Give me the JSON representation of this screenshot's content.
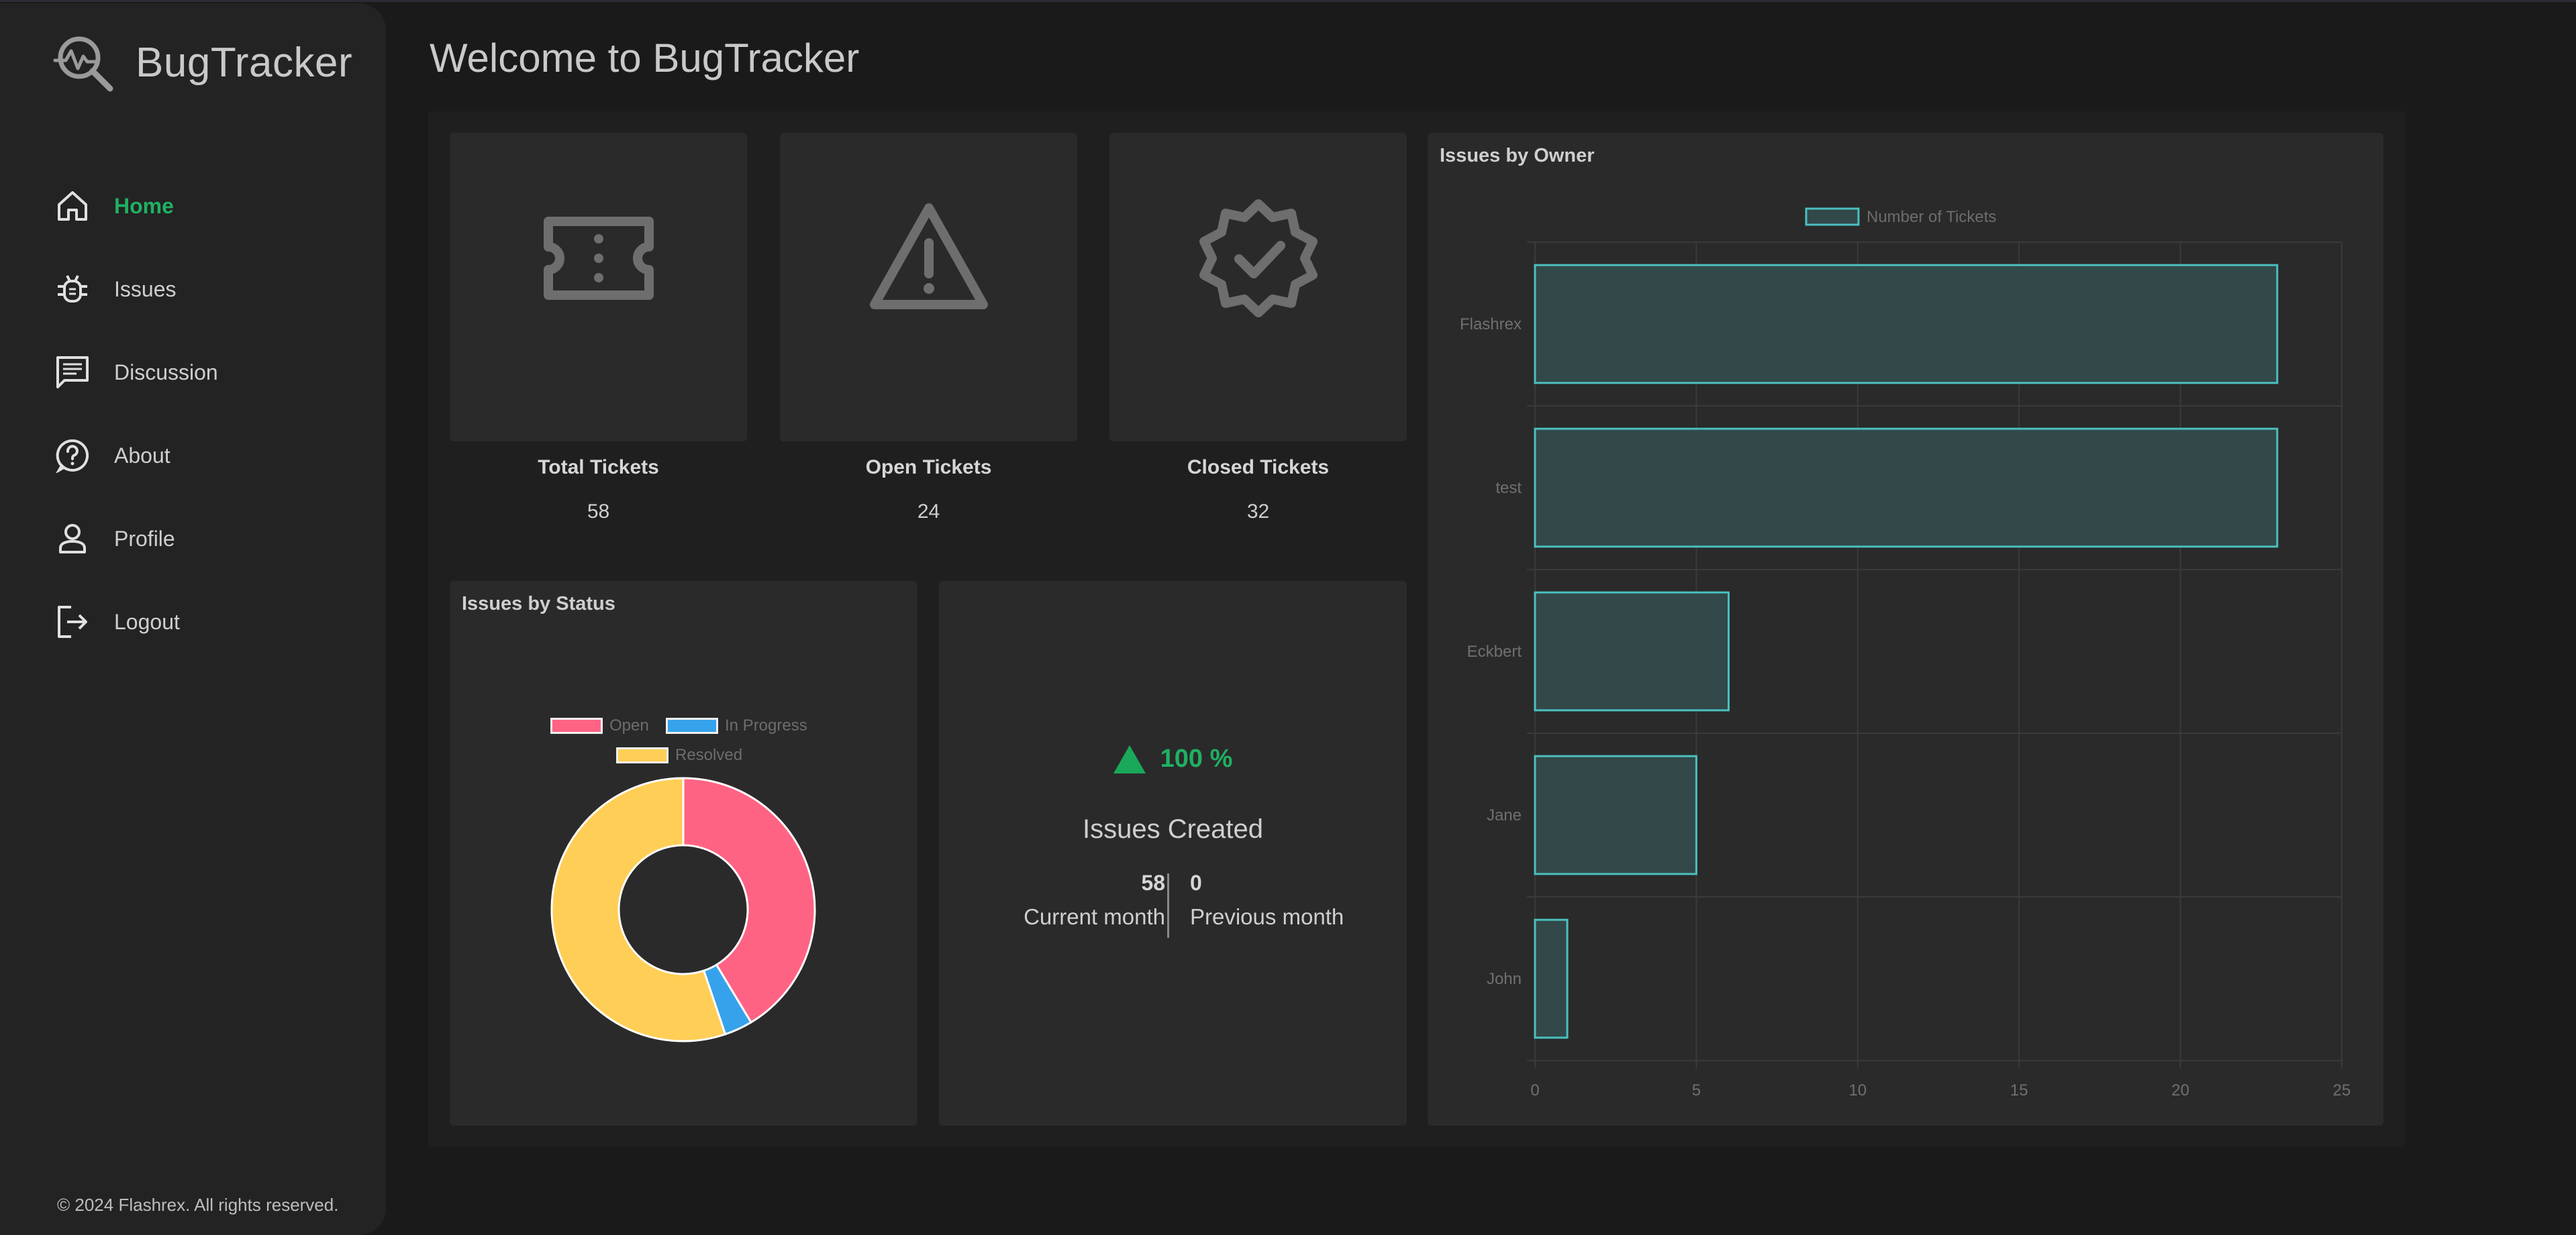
{
  "app": {
    "brand_name": "BugTracker",
    "page_title": "Welcome to BugTracker",
    "footer": "© 2024 Flashrex. All rights reserved.",
    "accent_color": "#1fb162"
  },
  "sidebar": {
    "items": [
      {
        "label": "Home",
        "icon": "home-icon",
        "active": true
      },
      {
        "label": "Issues",
        "icon": "bug-icon",
        "active": false
      },
      {
        "label": "Discussion",
        "icon": "chat-icon",
        "active": false
      },
      {
        "label": "About",
        "icon": "help-circle-icon",
        "active": false
      },
      {
        "label": "Profile",
        "icon": "user-icon",
        "active": false
      },
      {
        "label": "Logout",
        "icon": "logout-icon",
        "active": false
      }
    ]
  },
  "stats": {
    "total": {
      "label": "Total Tickets",
      "value": "58",
      "icon": "ticket-icon"
    },
    "open": {
      "label": "Open Tickets",
      "value": "24",
      "icon": "warning-icon"
    },
    "closed": {
      "label": "Closed Tickets",
      "value": "32",
      "icon": "verified-badge-icon"
    }
  },
  "created": {
    "trend": "100 %",
    "label": "Issues Created",
    "current_value": "58",
    "current_label": "Current month",
    "previous_value": "0",
    "previous_label": "Previous month"
  },
  "chart_data": [
    {
      "type": "pie",
      "title": "Issues by Status",
      "donut": true,
      "legend_position": "top",
      "categories": [
        "Open",
        "In Progress",
        "Resolved"
      ],
      "values": [
        24,
        2,
        32
      ],
      "colors": [
        "#ff6384",
        "#36a2eb",
        "#ffce56"
      ]
    },
    {
      "type": "bar",
      "orientation": "horizontal",
      "title": "Issues by Owner",
      "categories": [
        "Flashrex",
        "test",
        "Eckbert",
        "Jane",
        "John"
      ],
      "series": [
        {
          "name": "Number of Tickets",
          "values": [
            23,
            23,
            6,
            5,
            1
          ]
        }
      ],
      "xlim": [
        0,
        25
      ],
      "xticks": [
        "0",
        "5",
        "10",
        "15",
        "20",
        "25"
      ],
      "grid": true,
      "legend_position": "top",
      "bar_color": "#334849",
      "bar_border": "#4bc0c0"
    }
  ]
}
